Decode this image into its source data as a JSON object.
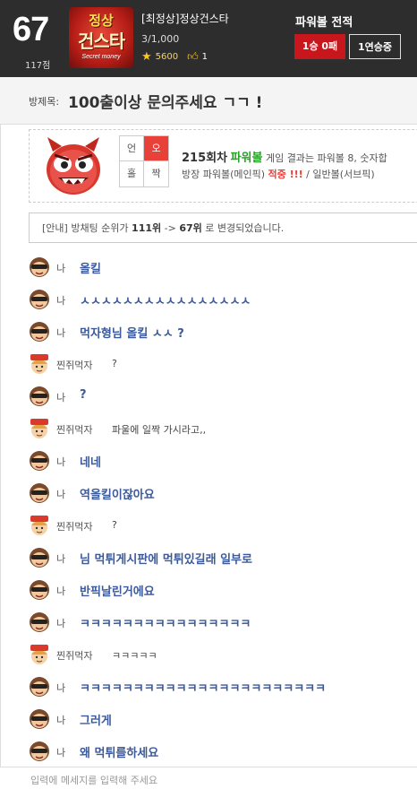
{
  "header": {
    "rank": "67",
    "points": "117점",
    "logo_top": "정상",
    "logo_main": "건스타",
    "logo_sub": "Secret money",
    "nickname": "[최정상]정상건스타",
    "count": "3/1,000",
    "stars": "5600",
    "likes": "1",
    "record_title": "파워볼 전적",
    "record_win": "1승 0패",
    "record_streak": "1연승중",
    "accent": "#c8161d"
  },
  "room": {
    "label": "방제목:",
    "title": "100출이상 문의주세요 ㄱㄱ !"
  },
  "result": {
    "grid": [
      "언",
      "오",
      "홀",
      "짝"
    ],
    "round": "215회차",
    "game": "파워볼",
    "line1_rest": "게임 결과는 파워볼 8, 숫자합",
    "line2_prefix": "방장 파워볼(메인픽)",
    "line2_hit": "적중 !!!",
    "line2_suffix": "/ 일반볼(서브픽)"
  },
  "notice": {
    "prefix": "[안내] 방채팅 순위가",
    "from": "111위",
    "arrow": "->",
    "to": "67위",
    "suffix": "로 변경되었습니다."
  },
  "chat": [
    {
      "who": "나",
      "type": "me",
      "text": "올킬"
    },
    {
      "who": "나",
      "type": "me",
      "text": "ㅅㅅㅅㅅㅅㅅㅅㅅㅅㅅㅅㅅㅅㅅㅅㅅ"
    },
    {
      "who": "나",
      "type": "me",
      "text": "먹자형님 올킬 ㅅㅅ ?"
    },
    {
      "who": "찐쥐먹자",
      "type": "other",
      "text": "?"
    },
    {
      "who": "나",
      "type": "me",
      "text": "?"
    },
    {
      "who": "찐쥐먹자",
      "type": "other",
      "text": "파울에 일짝 가시라고,,"
    },
    {
      "who": "나",
      "type": "me",
      "text": "네네"
    },
    {
      "who": "나",
      "type": "me",
      "text": "역올킬이잖아요"
    },
    {
      "who": "찐쥐먹자",
      "type": "other",
      "text": "?"
    },
    {
      "who": "나",
      "type": "me",
      "text": "님 먹튀게시판에 먹튀있길래 일부로"
    },
    {
      "who": "나",
      "type": "me",
      "text": "반픽날린거에요"
    },
    {
      "who": "나",
      "type": "me",
      "text": "ㅋㅋㅋㅋㅋㅋㅋㅋㅋㅋㅋㅋㅋㅋㅋㅋ"
    },
    {
      "who": "찐쥐먹자",
      "type": "other",
      "text": "ㅋㅋㅋㅋㅋ"
    },
    {
      "who": "나",
      "type": "me",
      "text": "ㅋㅋㅋㅋㅋㅋㅋㅋㅋㅋㅋㅋㅋㅋㅋㅋㅋㅋㅋㅋㅋㅋㅋ"
    },
    {
      "who": "나",
      "type": "me",
      "text": "그러게"
    },
    {
      "who": "나",
      "type": "me",
      "text": "왜 먹튀를하세요"
    }
  ],
  "input": {
    "placeholder": "입력에 메세지를 입력해 주세요"
  }
}
